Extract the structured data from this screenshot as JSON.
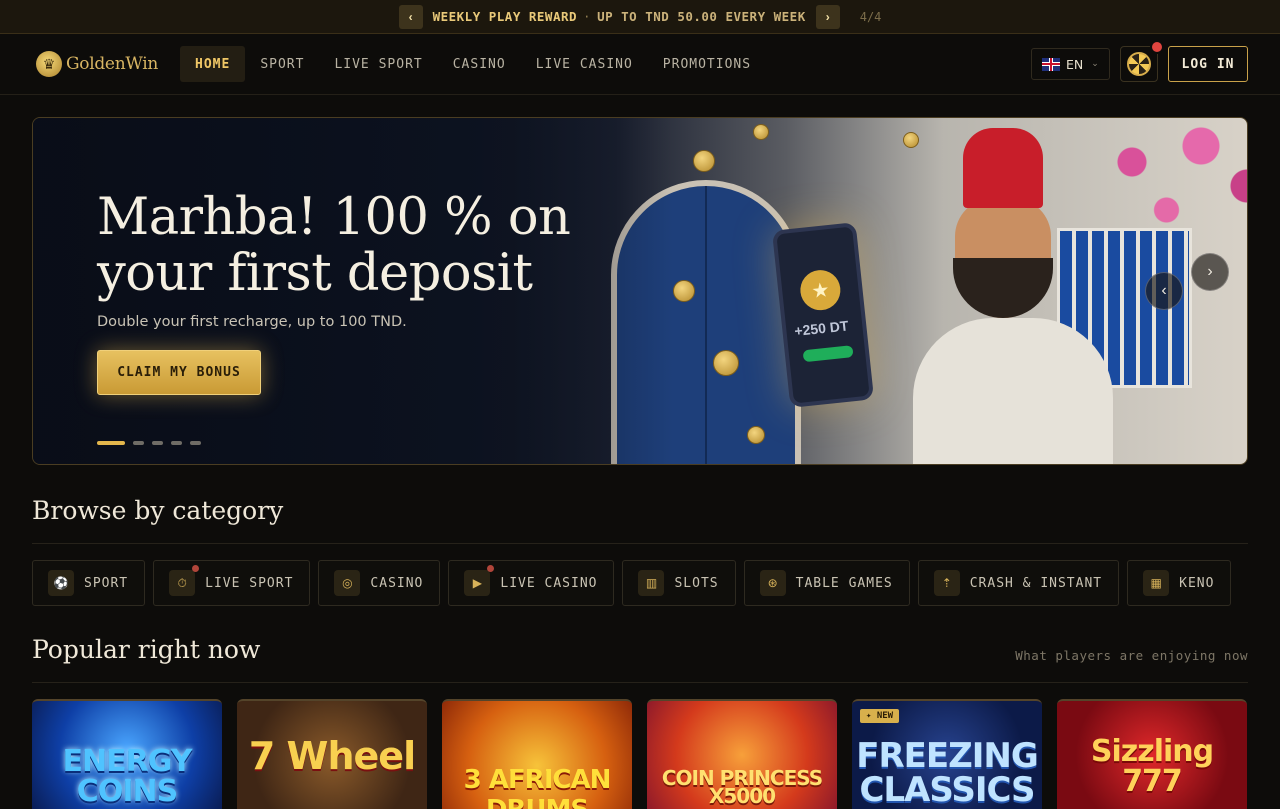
{
  "topbar": {
    "reward_title": "WEEKLY PLAY REWARD",
    "reward_sub": "UP TO TND 50.00 EVERY WEEK",
    "counter": "4/4",
    "prev_icon": "chevron-left-icon",
    "next_icon": "chevron-right-icon"
  },
  "header": {
    "brand": "GoldenWin",
    "nav": [
      "HOME",
      "SPORT",
      "LIVE SPORT",
      "CASINO",
      "LIVE CASINO",
      "PROMOTIONS"
    ],
    "active_nav": "HOME",
    "language": "EN",
    "login": "LOG IN"
  },
  "hero": {
    "title": "Marhba! 100 % on your first deposit",
    "subtitle": "Double your first recharge, up to 100 TND.",
    "cta": "CLAIM MY BONUS",
    "phone_amount": "+250 DT",
    "slides_total": 5,
    "active_slide": 1
  },
  "categories": {
    "title": "Browse by category",
    "items": [
      {
        "label": "SPORT",
        "icon": "soccer-ball-icon",
        "live": false
      },
      {
        "label": "LIVE SPORT",
        "icon": "stopwatch-icon",
        "live": true
      },
      {
        "label": "CASINO",
        "icon": "roulette-icon",
        "live": false
      },
      {
        "label": "LIVE CASINO",
        "icon": "live-video-icon",
        "live": true
      },
      {
        "label": "SLOTS",
        "icon": "slot-machine-icon",
        "live": false
      },
      {
        "label": "TABLE GAMES",
        "icon": "chip-icon",
        "live": false
      },
      {
        "label": "CRASH & INSTANT",
        "icon": "rocket-icon",
        "live": false
      },
      {
        "label": "KENO",
        "icon": "keno-grid-icon",
        "live": false
      }
    ]
  },
  "popular": {
    "title": "Popular right now",
    "note": "What players are enjoying now",
    "games": [
      {
        "title": "ENERGY COINS",
        "badge": ""
      },
      {
        "title": "7 Wheel",
        "badge": ""
      },
      {
        "title": "3 AFRICAN DRUMS",
        "badge": ""
      },
      {
        "title": "COIN PRINCESS X5000",
        "badge": ""
      },
      {
        "title": "FREEZING CLASSICS",
        "badge": "NEW"
      },
      {
        "title": "Sizzling 777",
        "badge": ""
      }
    ]
  },
  "colors": {
    "accent": "#e3b64c",
    "background": "#0d0c0a",
    "live_dot": "#b0453a"
  }
}
